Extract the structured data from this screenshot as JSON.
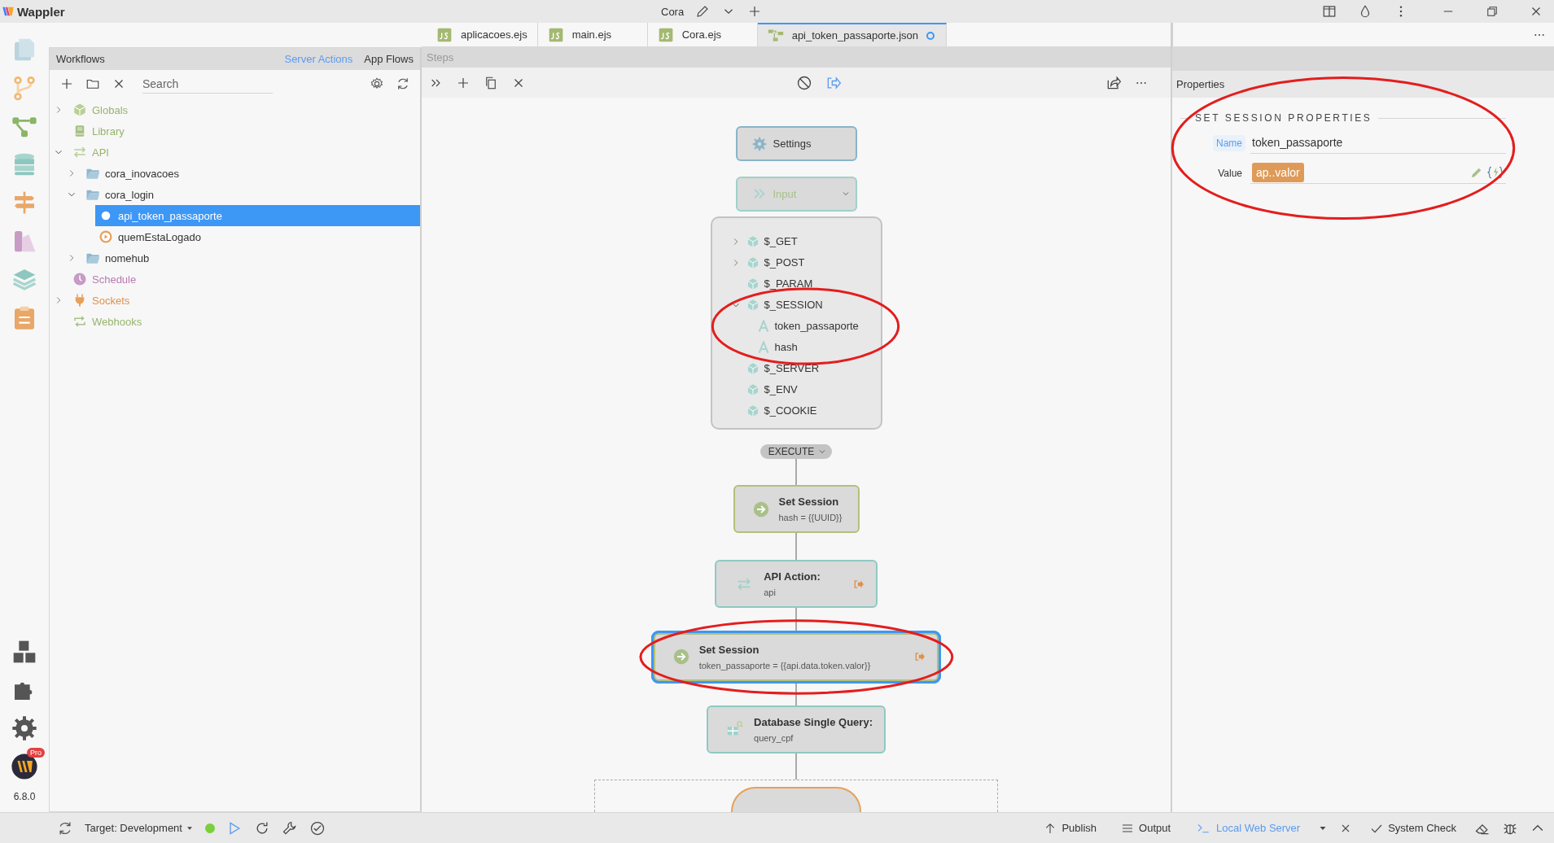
{
  "title_bar": {
    "app_name": "Wappler",
    "project": "Cora"
  },
  "rail": {
    "badge": "Pro",
    "version": "6.8.0"
  },
  "workflows": {
    "title": "Workflows",
    "tabs": [
      {
        "label": "Server Actions",
        "selected": true
      },
      {
        "label": "App Flows",
        "selected": false
      }
    ],
    "search": {
      "placeholder": "Search"
    },
    "tree": [
      {
        "label": "Globals",
        "kind": "globals",
        "expanded": false,
        "selected": false
      },
      {
        "label": "Library",
        "kind": "library",
        "selected": false
      },
      {
        "label": "API",
        "kind": "api",
        "expanded": true,
        "selected": false,
        "children": [
          {
            "label": "cora_inovacoes",
            "kind": "folder",
            "expanded": false,
            "selected": false
          },
          {
            "label": "cora_login",
            "kind": "folder",
            "expanded": true,
            "selected": false,
            "children": [
              {
                "label": "api_token_passaporte",
                "kind": "action",
                "selected": true
              },
              {
                "label": "quemEstaLogado",
                "kind": "action",
                "selected": false
              }
            ]
          },
          {
            "label": "nomehub",
            "kind": "folder",
            "expanded": false,
            "selected": false
          }
        ]
      },
      {
        "label": "Schedule",
        "kind": "schedule",
        "selected": false
      },
      {
        "label": "Sockets",
        "kind": "sockets",
        "expanded": false,
        "selected": false
      },
      {
        "label": "Webhooks",
        "kind": "webhooks",
        "selected": false
      }
    ]
  },
  "editor_tabs": [
    {
      "label": "aplicacoes.ejs",
      "kind": "js",
      "selected": false,
      "modified": false
    },
    {
      "label": "main.ejs",
      "kind": "js",
      "selected": false,
      "modified": false
    },
    {
      "label": "Cora.ejs",
      "kind": "js",
      "selected": false,
      "modified": false
    },
    {
      "label": "api_token_passaporte.json",
      "kind": "flow",
      "selected": true,
      "modified": true
    }
  ],
  "steps": {
    "title": "Steps",
    "settings": {
      "label": "Settings"
    },
    "input": {
      "label": "Input",
      "expanded": true,
      "items": [
        {
          "label": "$_GET",
          "kind": "object",
          "expanded": false,
          "circled": false
        },
        {
          "label": "$_POST",
          "kind": "object",
          "expanded": false,
          "circled": false
        },
        {
          "label": "$_PARAM",
          "kind": "object",
          "circled": false
        },
        {
          "label": "$_SESSION",
          "kind": "object",
          "expanded": true,
          "circled": true,
          "children": [
            {
              "label": "token_passaporte",
              "kind": "text"
            },
            {
              "label": "hash",
              "kind": "text"
            }
          ]
        },
        {
          "label": "$_SERVER",
          "kind": "object",
          "circled": false
        },
        {
          "label": "$_ENV",
          "kind": "object",
          "circled": false
        },
        {
          "label": "$_COOKIE",
          "kind": "object",
          "circled": false
        }
      ]
    },
    "execute": {
      "label": "EXECUTE"
    },
    "nodes": [
      {
        "kind": "set_session",
        "title": "Set Session",
        "detail": "hash = {{UUID}}",
        "selected": false,
        "output": false,
        "circled": false
      },
      {
        "kind": "api_action",
        "title": "API Action:",
        "detail": "api",
        "selected": false,
        "output": true,
        "circled": false
      },
      {
        "kind": "set_session",
        "title": "Set Session",
        "detail": "token_passaporte = {{api.data.token.valor}}",
        "selected": true,
        "output": true,
        "circled": true
      },
      {
        "kind": "db_query",
        "title": "Database Single Query:",
        "detail": "query_cpf",
        "selected": false,
        "output": false,
        "circled": false
      },
      {
        "kind": "condition",
        "selected": false
      }
    ]
  },
  "properties": {
    "title": "Properties",
    "section": "SET SESSION PROPERTIES",
    "circled": true,
    "fields": [
      {
        "label": "Name",
        "kind": "text",
        "value": "token_passaporte",
        "highlighted": true
      },
      {
        "label": "Value",
        "kind": "expression",
        "value": "ap..valor",
        "highlighted": false
      }
    ]
  },
  "status_bar": {
    "target": "Target: Development",
    "server_running": true,
    "items": [
      {
        "label": "Publish",
        "kind": "publish",
        "selected": false
      },
      {
        "label": "Output",
        "kind": "output",
        "selected": false
      },
      {
        "label": "Local Web Server",
        "kind": "terminal",
        "selected": true
      },
      {
        "label": "System Check",
        "kind": "check",
        "selected": false
      }
    ]
  }
}
